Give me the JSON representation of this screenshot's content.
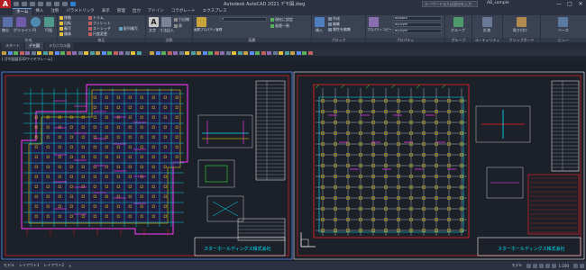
{
  "titlebar": {
    "app_logo": "A",
    "title": "Autodesk AutoCAD 2021  デモ図.dwg",
    "search_placeholder": "キーワードまたは語句を入力",
    "user": "AB_sample",
    "minimize": "—",
    "maximize": "□",
    "close": "✕"
  },
  "ribbon_tabs": [
    "ホーム",
    "挿入",
    "注釈",
    "パラメトリック",
    "表示",
    "管理",
    "出力",
    "アドイン",
    "コラボレート",
    "エクスプレス"
  ],
  "ribbon": {
    "draw": {
      "title": "作成",
      "line": "線分",
      "polyline": "ポリライン",
      "circle": "円",
      "arc": "円弧"
    },
    "modify": {
      "title": "修正",
      "move": "移動",
      "rotate": "回転",
      "copy": "複写",
      "mirror": "鏡像",
      "stretch": "ストレッチ",
      "scale": "尺度変更",
      "trim": "トリム",
      "fillet": "フィレット",
      "array": "配列複写"
    },
    "annotation": {
      "title": "注釈",
      "text": "文字",
      "dimension": "寸法記入",
      "leader": "引出線",
      "table": "表"
    },
    "layers": {
      "title": "画層",
      "layer_properties": "画層プロパティ管理",
      "current_layer": "0",
      "make_current": "現在に設定",
      "match_layer": "画層一致"
    },
    "block": {
      "title": "ブロック",
      "insert": "挿入",
      "create": "作成",
      "edit": "編集",
      "edit_attributes": "属性を編集"
    },
    "properties": {
      "title": "プロパティ",
      "match": "プロパティコピー",
      "color": "ByBlock",
      "linetype": "ByLayer",
      "lineweight": "ByLayer"
    },
    "groups": {
      "title": "グループ",
      "group": "グループ"
    },
    "utilities": {
      "title": "ユーティリティ",
      "measure": "計測"
    },
    "clipboard": {
      "title": "クリップボード",
      "paste": "貼り付け"
    },
    "view": {
      "title": "ビュー",
      "base": "ベース"
    }
  },
  "file_tabs": [
    "スタート",
    "デモ図",
    "メカニカル図"
  ],
  "viewport_label": "[-][平面図][2Dワイヤフレーム]",
  "drawings": {
    "left_company": "スターホールディングス株式会社",
    "right_company": "スターホールディングス株式会社"
  },
  "status": {
    "model": "モデル",
    "layout1": "レイアウト1",
    "layout2": "レイアウト2",
    "add": "+",
    "coords": "モデル",
    "scale": "1:100"
  },
  "colors": {
    "accent": "#b81f24",
    "cyan": "#00e5ff",
    "magenta": "#ff3cff",
    "yellow": "#ffe600",
    "red": "#ff2020",
    "white": "#f0f0f0",
    "green": "#3cff3c"
  }
}
